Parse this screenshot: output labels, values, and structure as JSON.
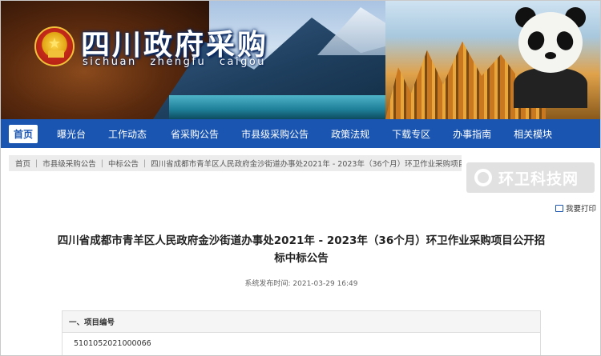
{
  "site": {
    "title": "四川政府采购",
    "subtitle": "sichuan zhengfu caigou"
  },
  "nav": {
    "items": [
      "首页",
      "曝光台",
      "工作动态",
      "省采购公告",
      "市县级采购公告",
      "政策法规",
      "下载专区",
      "办事指南",
      "相关模块"
    ],
    "active_index": 0
  },
  "breadcrumb": [
    "首页",
    "市县级采购公告",
    "中标公告",
    "四川省成都市青羊区人民政府金沙街道办事处2021年 - 2023年（36个月）环卫作业采购项目..."
  ],
  "watermark": "环卫科技网",
  "print_label": "我要打印",
  "document": {
    "title_line1": "四川省成都市青羊区人民政府金沙街道办事处2021年 - 2023年（36个月）环卫作业采购项目公开招",
    "title_line2": "标中标公告",
    "publish_label": "系统发布时间:",
    "publish_time": "2021-03-29 16:49"
  },
  "section": {
    "heading": "一、项目编号",
    "value": "5101052021000066"
  },
  "colors": {
    "nav_bg": "#1a55b2",
    "title_text": "#ffffff"
  }
}
